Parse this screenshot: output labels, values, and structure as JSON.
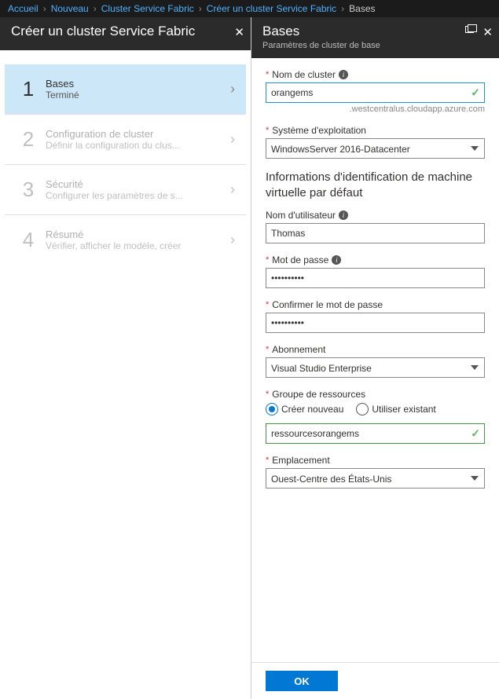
{
  "breadcrumbs": {
    "0": "Accueil",
    "1": "Nouveau",
    "2": "Cluster Service Fabric",
    "3": "Créer un cluster Service Fabric",
    "4": "Bases"
  },
  "left_blade": {
    "title": "Créer un cluster Service Fabric"
  },
  "wizard": {
    "steps": {
      "0": {
        "num": "1",
        "title": "Bases",
        "sub": "Terminé"
      },
      "1": {
        "num": "2",
        "title": "Configuration de cluster",
        "sub": "Définir la configuration du clus..."
      },
      "2": {
        "num": "3",
        "title": "Sécurité",
        "sub": "Configurer les paramètres de s..."
      },
      "3": {
        "num": "4",
        "title": "Résumé",
        "sub": "Vérifier, afficher le modèle, créer"
      }
    }
  },
  "right_blade": {
    "title": "Bases",
    "subtitle": "Paramètres de cluster de base"
  },
  "form": {
    "cluster_name": {
      "label": "Nom de cluster",
      "value": "orangems",
      "suffix": ".westcentralus.cloudapp.azure.com"
    },
    "os": {
      "label": "Système d'exploitation",
      "value": "WindowsServer 2016-Datacenter"
    },
    "vm_heading": "Informations d'identification de machine virtuelle par défaut",
    "username": {
      "label": "Nom d'utilisateur",
      "value": "Thomas"
    },
    "password": {
      "label": "Mot de passe",
      "value": "••••••••••"
    },
    "confirm": {
      "label": "Confirmer le mot de passe",
      "value": "••••••••••"
    },
    "subscription": {
      "label": "Abonnement",
      "value": "Visual Studio Enterprise"
    },
    "resource_group": {
      "label": "Groupe de ressources",
      "option_new": "Créer nouveau",
      "option_existing": "Utiliser existant",
      "value": "ressourcesorangems"
    },
    "location": {
      "label": "Emplacement",
      "value": "Ouest-Centre des États-Unis"
    }
  },
  "footer": {
    "ok": "OK"
  }
}
